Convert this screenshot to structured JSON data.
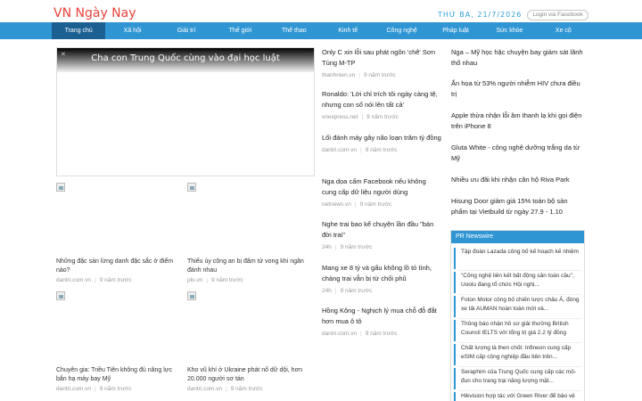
{
  "header": {
    "logo": "VN Ngày Nay",
    "date": "THỨ BA, 21/7/2026",
    "login_label": "Login via Facebook"
  },
  "nav": {
    "items": [
      "Trang chủ",
      "Xã hội",
      "Giải trí",
      "Thế giới",
      "Thể thao",
      "Kinh tế",
      "Công nghệ",
      "Pháp luật",
      "Sức khỏe",
      "Xe cộ"
    ],
    "active_index": 0
  },
  "hero": {
    "title": "Cha con Trung Quốc cùng vào đại học luật"
  },
  "thumbs": [
    {
      "title": "Những đặc sản lừng danh đặc sắc ở điểm nào?",
      "source": "dantri.com.vn",
      "time": "9 năm trước"
    },
    {
      "title": "Thiếu úy công an bị đâm tử vong khi ngăn đánh nhau",
      "source": "plo.vn",
      "time": "9 năm trước"
    },
    {
      "title": "Chuyên gia: Triều Tiên không đủ năng lực bắn hạ máy bay Mỹ",
      "source": "dantri.com.vn",
      "time": "9 năm trước"
    },
    {
      "title": "Kho vũ khí ở Ukraine phát nổ dữ dội, hơn 20.000 người sơ tán",
      "source": "dantri.com.vn",
      "time": "9 năm trước"
    }
  ],
  "mid_news": [
    {
      "title": "Only C xin lỗi sau phát ngôn 'chê' Sơn Tùng M-TP",
      "source": "thanhnien.vn",
      "time": "9 năm trước"
    },
    {
      "title": "Ronaldo: 'Lời chỉ trích tôi ngày càng tệ, nhưng con số nói lên tất cả'",
      "source": "vnexpress.net",
      "time": "9 năm trước"
    },
    {
      "title": "Lối đánh máy gây não loạn trăm tỷ đồng",
      "source": "dantri.com.vn",
      "time": "9 năm trước"
    },
    {
      "title": "Nga dọa cấm Facebook nếu không cung cấp dữ liệu người dùng",
      "source": "netnews.vn",
      "time": "9 năm trước"
    },
    {
      "title": "Nghe trai bao kể chuyện lần đầu \"bán đời trai\"",
      "source": "24h",
      "time": "9 năm trước"
    },
    {
      "title": "Mang xe 8 tỷ và gấu không lồ tỏ tình, chàng trai vẫn bị từ chối phũ",
      "source": "24h",
      "time": "9 năm trước"
    },
    {
      "title": "Hồng Kông - Nghịch lý mua chỗ đỗ đắt hơn mua ô tô",
      "source": "dantri.com.vn",
      "time": "9 năm trước"
    }
  ],
  "right_news": [
    "Nga – Mỹ học hặc chuyện bay giám sát lãnh thổ nhau",
    "Ấn họa từ 53% người nhiễm HIV chưa điều trị",
    "Apple thừa nhận lỗi âm thanh lạ khi gọi điện trên iPhone 8",
    "Gluta White - công nghệ dưỡng trắng da từ Mỹ",
    "Nhiều ưu đãi khi nhận căn hộ Riva Park",
    "Hisung Door giảm giá 15% toàn bộ sản phẩm tại Vietbuild từ ngày 27.9 - 1.10"
  ],
  "pr": {
    "title": "PR Newswire",
    "items": [
      "Tập đoàn Lazada công bố kế hoạch kế nhiệm",
      "\"Công nghệ liên kết bất động sản toàn cầu\", Uoolu đang tổ chức Hội nghị...",
      "Foton Motor công bố chiến lược châu Á, đóng xe tải AUMAN hoàn toàn mới và...",
      "Thông báo nhận hồ sơ giải thưởng British Council IELTS với tổng trị giá 2.2 tỷ đồng",
      "Chất lượng là then chốt: Infineon cung cấp eSIM cấp công nghiệp đầu tiên trên...",
      "Seraphim của Trung Quốc cung cấp các mô-đun cho trang trại năng lượng mặt...",
      "Hikvision hợp tác với Green River để bảo vệ hệ sinh thái thiên nhiên ở Tây..."
    ]
  }
}
